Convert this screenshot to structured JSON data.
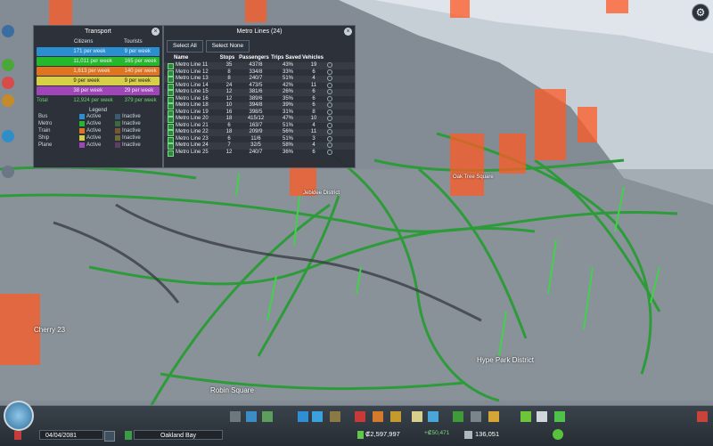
{
  "transport": {
    "title": "Transport",
    "col_citizens": "Citizens",
    "col_tourists": "Tourists",
    "rows": [
      {
        "mode": "bus",
        "citizens": "171 per week",
        "tourists": "9 per week",
        "color": "#2a8fd0"
      },
      {
        "mode": "metro",
        "citizens": "11,011 per week",
        "tourists": "165 per week",
        "color": "#25b82c"
      },
      {
        "mode": "train",
        "citizens": "1,613 per week",
        "tourists": "140 per week",
        "color": "#e0741f"
      },
      {
        "mode": "ship",
        "citizens": "9 per week",
        "tourists": "9 per week",
        "color": "#d8cf49"
      },
      {
        "mode": "plane",
        "citizens": "38 per week",
        "tourists": "29 per week",
        "color": "#a045b8"
      }
    ],
    "total_label": "Total",
    "total_citizens": "12,924 per week",
    "total_tourists": "379 per week",
    "legend_title": "Legend",
    "legend": [
      {
        "name": "Bus",
        "active": "Active",
        "inactive": "Inactive",
        "color": "#2a8fd0",
        "icolor": "#3b5b70"
      },
      {
        "name": "Metro",
        "active": "Active",
        "inactive": "Inactive",
        "color": "#25b82c",
        "icolor": "#3a6a3d"
      },
      {
        "name": "Train",
        "active": "Active",
        "inactive": "Inactive",
        "color": "#e0741f",
        "icolor": "#7a5434"
      },
      {
        "name": "Ship",
        "active": "Active",
        "inactive": "Inactive",
        "color": "#d8cf49",
        "icolor": "#6e6a3a"
      },
      {
        "name": "Plane",
        "active": "Active",
        "inactive": "Inactive",
        "color": "#a045b8",
        "icolor": "#5d3f66"
      }
    ]
  },
  "metro": {
    "title": "Metro Lines (24)",
    "select_all": "Select All",
    "select_none": "Select None",
    "headers": {
      "name": "Name",
      "stops": "Stops",
      "passengers": "Passengers",
      "trips": "Trips Saved",
      "vehicles": "Vehicles"
    },
    "lines": [
      {
        "name": "Metro Line 11",
        "stops": "35",
        "passengers": "437/8",
        "trips": "43%",
        "vehicles": "19"
      },
      {
        "name": "Metro Line 12",
        "stops": "8",
        "passengers": "334/8",
        "trips": "33%",
        "vehicles": "6"
      },
      {
        "name": "Metro Line 13",
        "stops": "8",
        "passengers": "240/7",
        "trips": "51%",
        "vehicles": "4"
      },
      {
        "name": "Metro Line 14",
        "stops": "24",
        "passengers": "473/5",
        "trips": "42%",
        "vehicles": "11"
      },
      {
        "name": "Metro Line 15",
        "stops": "12",
        "passengers": "381/6",
        "trips": "26%",
        "vehicles": "6"
      },
      {
        "name": "Metro Line 16",
        "stops": "12",
        "passengers": "389/6",
        "trips": "35%",
        "vehicles": "6"
      },
      {
        "name": "Metro Line 18",
        "stops": "10",
        "passengers": "394/8",
        "trips": "39%",
        "vehicles": "6"
      },
      {
        "name": "Metro Line 19",
        "stops": "16",
        "passengers": "398/5",
        "trips": "31%",
        "vehicles": "8"
      },
      {
        "name": "Metro Line 20",
        "stops": "18",
        "passengers": "415/12",
        "trips": "47%",
        "vehicles": "10"
      },
      {
        "name": "Metro Line 21",
        "stops": "6",
        "passengers": "163/7",
        "trips": "51%",
        "vehicles": "4"
      },
      {
        "name": "Metro Line 22",
        "stops": "18",
        "passengers": "209/9",
        "trips": "56%",
        "vehicles": "11"
      },
      {
        "name": "Metro Line 23",
        "stops": "6",
        "passengers": "11/6",
        "trips": "51%",
        "vehicles": "3"
      },
      {
        "name": "Metro Line 24",
        "stops": "7",
        "passengers": "32/5",
        "trips": "58%",
        "vehicles": "4"
      },
      {
        "name": "Metro Line 25",
        "stops": "12",
        "passengers": "240/7",
        "trips": "36%",
        "vehicles": "6"
      }
    ]
  },
  "map_labels": {
    "district1": "Cherry 23",
    "district2": "Robin Square",
    "district3": "Hype Park District",
    "district4": "Oak Tree Square",
    "district5": "Jebidee District"
  },
  "bottom": {
    "date": "04/04/2081",
    "city": "Oakland Bay",
    "money": "₡2,597,997",
    "income": "+₡50,471",
    "population": "136,051"
  },
  "colors": {
    "metro_line": "#35b043",
    "tower_red": "#ff5a2a",
    "panel_bg": "#262c34"
  }
}
